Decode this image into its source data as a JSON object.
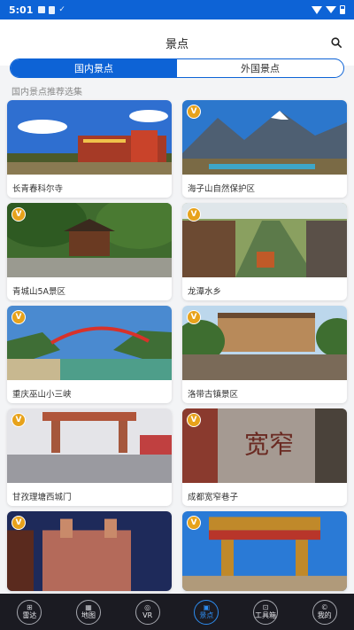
{
  "status_bar": {
    "time": "5:01"
  },
  "header": {
    "title": "景点"
  },
  "tabs": [
    {
      "label": "国内景点",
      "active": true
    },
    {
      "label": "外国景点",
      "active": false
    }
  ],
  "section_title": "国内景点推荐选集",
  "badge_letter": "V",
  "cards": [
    {
      "label": "长青春科尔寺",
      "vip": false
    },
    {
      "label": "海子山自然保护区",
      "vip": true
    },
    {
      "label": "青城山5A景区",
      "vip": true
    },
    {
      "label": "龙潭水乡",
      "vip": true
    },
    {
      "label": "重庆巫山小三峡",
      "vip": true
    },
    {
      "label": "洛带古镇景区",
      "vip": true
    },
    {
      "label": "甘孜理塘西城门",
      "vip": true
    },
    {
      "label": "成都宽窄巷子",
      "vip": true
    },
    {
      "label": "",
      "vip": true
    },
    {
      "label": "",
      "vip": true
    }
  ],
  "bottom_nav": [
    {
      "label": "雷达",
      "icon": "radar-icon",
      "active": false
    },
    {
      "label": "地图",
      "icon": "map-icon",
      "active": false
    },
    {
      "label": "VR",
      "icon": "vr-icon",
      "active": false
    },
    {
      "label": "景点",
      "icon": "scenic-icon",
      "active": true
    },
    {
      "label": "工具箱",
      "icon": "toolbox-icon",
      "active": false
    },
    {
      "label": "我的",
      "icon": "profile-icon",
      "active": false
    }
  ],
  "colors": {
    "primary": "#0d63d6",
    "badge": "#e7a21b",
    "nav_bg": "#1b1b22",
    "nav_active": "#2d8cf0"
  }
}
